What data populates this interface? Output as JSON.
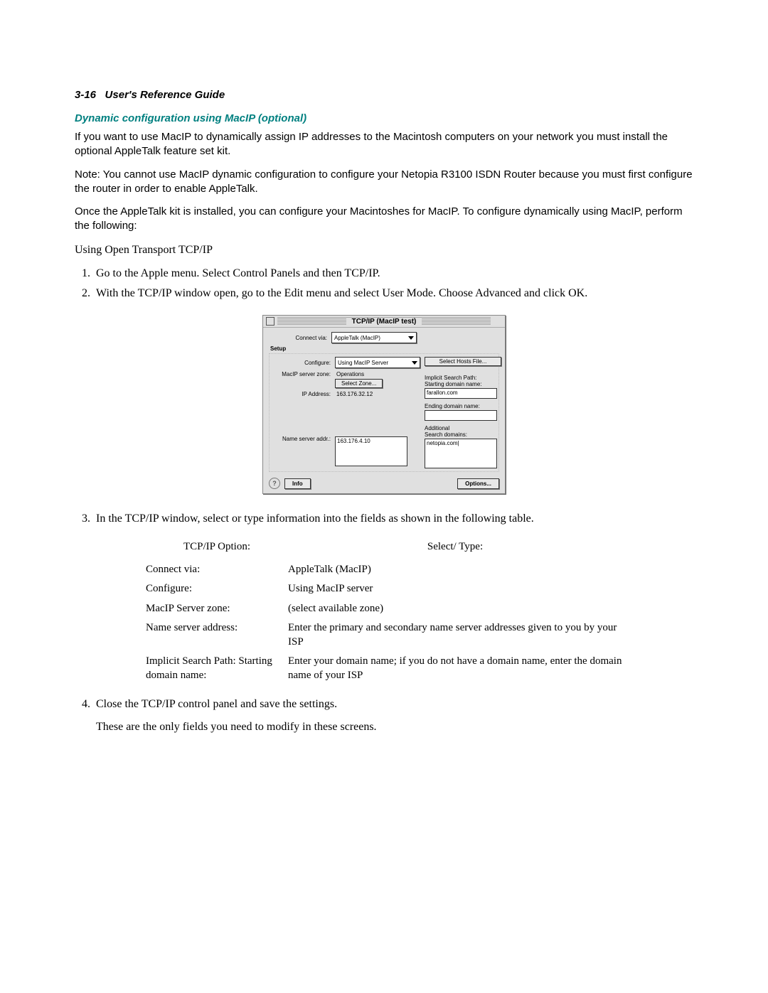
{
  "header": {
    "page_ref": "3-16",
    "guide_title": "User's Reference Guide"
  },
  "subheading": "Dynamic configuration using MacIP (optional)",
  "paragraphs": {
    "intro": "If you want to use MacIP to dynamically assign IP addresses to the Macintosh computers on your network you must install the optional AppleTalk feature set kit.",
    "note": "Note:  You cannot use MacIP dynamic configuration to configure your Netopia R3100 ISDN Router because you must first configure the router in order to enable AppleTalk.",
    "once": "Once the AppleTalk kit is installed, you can configure your Macintoshes for MacIP. To configure dynamically using MacIP, perform the following:",
    "using": "Using Open Transport TCP/IP"
  },
  "list": {
    "i1": "Go to the Apple menu. Select Control Panels and then TCP/IP.",
    "i2": "With the TCP/IP window open, go to the Edit menu and select User Mode. Choose Advanced and click OK.",
    "i3": "In the TCP/IP window, select or type information into the fields as shown in the following table.",
    "i4": "Close the TCP/IP control panel and save the settings.",
    "i4b": "These are the only fields you need to modify in these screens."
  },
  "dialog": {
    "title": "TCP/IP (MacIP test)",
    "connect_via_lbl": "Connect via:",
    "connect_via_val": "AppleTalk (MacIP)",
    "setup_lbl": "Setup",
    "configure_lbl": "Configure:",
    "configure_val": "Using MacIP Server",
    "select_hosts_btn": "Select Hosts File...",
    "zone_lbl": "MacIP server zone:",
    "zone_val": "Operations",
    "select_zone_btn": "Select Zone...",
    "ip_lbl": "IP Address:",
    "ip_val": "163.176.32.12",
    "implicit_lbl1": "Implicit Search Path:",
    "implicit_lbl2": "Starting domain name:",
    "implicit_val": "farallon.com",
    "ending_lbl": "Ending domain name:",
    "ending_val": "",
    "addl_lbl1": "Additional",
    "addl_lbl2": "Search domains:",
    "ns_lbl": "Name server addr.:",
    "ns_val": "163.176.4.10",
    "addl_val": "netopia.com|",
    "info_btn": "Info",
    "options_btn": "Options..."
  },
  "table": {
    "head_left": "TCP/IP Option:",
    "head_right": "Select/ Type:",
    "rows": [
      {
        "l": "Connect via:",
        "r": "AppleTalk (MacIP)"
      },
      {
        "l": "Configure:",
        "r": "Using MacIP server"
      },
      {
        "l": "MacIP Server zone:",
        "r": "(select available zone)"
      },
      {
        "l": "Name server address:",
        "r": "Enter the primary and secondary name server addresses given to you by your ISP"
      },
      {
        "l": "Implicit Search Path: Starting domain name:",
        "r": "Enter your domain name; if you do not have a domain name, enter the domain name of your ISP"
      }
    ]
  }
}
